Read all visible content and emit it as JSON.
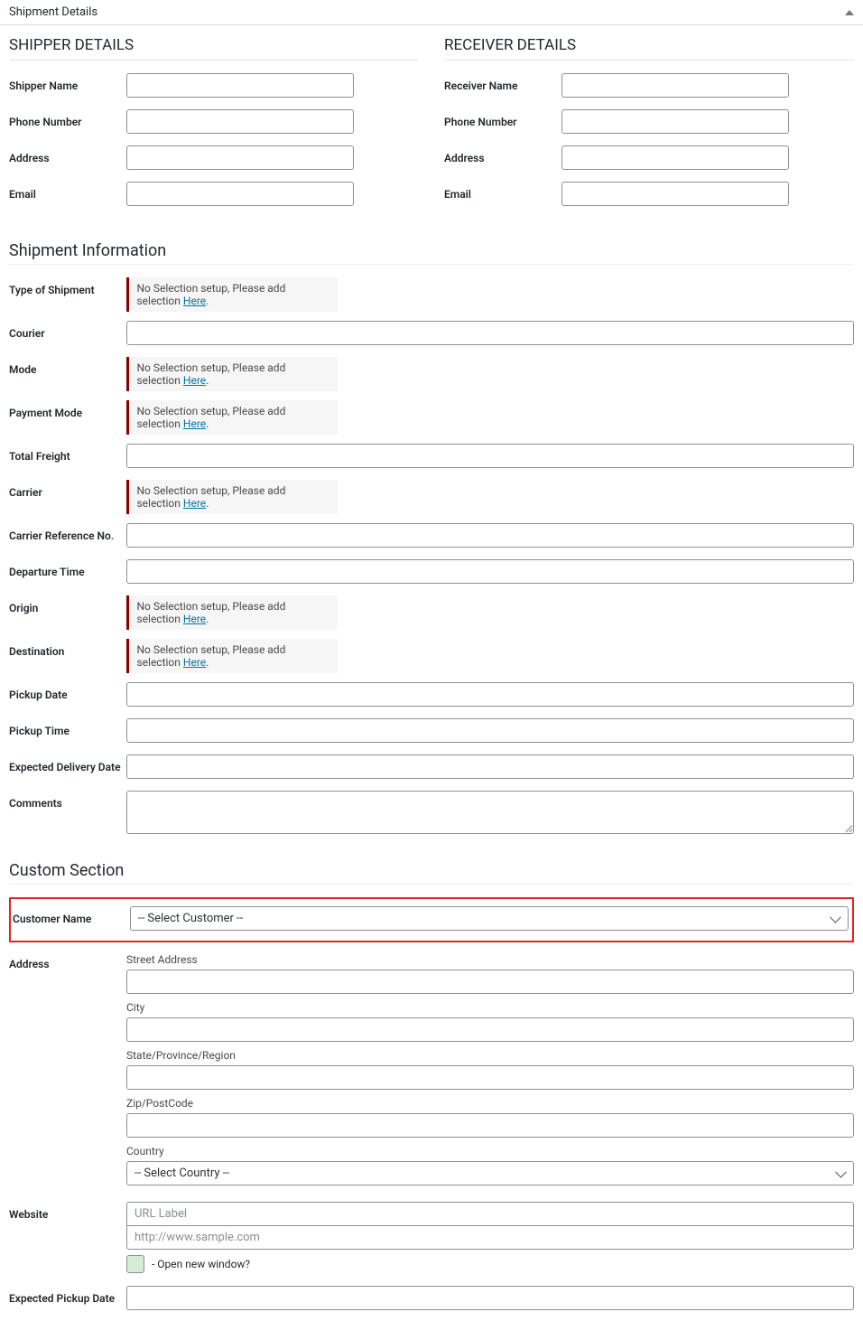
{
  "header": {
    "title": "Shipment Details"
  },
  "shipper": {
    "heading": "SHIPPER DETAILS",
    "name": {
      "label": "Shipper Name",
      "value": ""
    },
    "phone": {
      "label": "Phone Number",
      "value": ""
    },
    "address": {
      "label": "Address",
      "value": ""
    },
    "email": {
      "label": "Email",
      "value": ""
    }
  },
  "receiver": {
    "heading": "RECEIVER DETAILS",
    "name": {
      "label": "Receiver Name",
      "value": ""
    },
    "phone": {
      "label": "Phone Number",
      "value": ""
    },
    "address": {
      "label": "Address",
      "value": ""
    },
    "email": {
      "label": "Email",
      "value": ""
    }
  },
  "info": {
    "heading": "Shipment Information",
    "notice_prefix": "No Selection setup, Please add selection ",
    "notice_link": "Here",
    "notice_suffix": ".",
    "type": {
      "label": "Type of Shipment"
    },
    "courier": {
      "label": "Courier",
      "value": ""
    },
    "mode": {
      "label": "Mode"
    },
    "payment_mode": {
      "label": "Payment Mode"
    },
    "total_freight": {
      "label": "Total Freight",
      "value": ""
    },
    "carrier": {
      "label": "Carrier"
    },
    "carrier_ref": {
      "label": "Carrier Reference No.",
      "value": ""
    },
    "departure_time": {
      "label": "Departure Time",
      "value": ""
    },
    "origin": {
      "label": "Origin"
    },
    "destination": {
      "label": "Destination"
    },
    "pickup_date": {
      "label": "Pickup Date",
      "value": ""
    },
    "pickup_time": {
      "label": "Pickup Time",
      "value": ""
    },
    "expected_delivery": {
      "label": "Expected Delivery Date",
      "value": ""
    },
    "comments": {
      "label": "Comments",
      "value": ""
    }
  },
  "custom": {
    "heading": "Custom Section",
    "customer_name": {
      "label": "Customer Name",
      "selected": "-- Select Customer --"
    },
    "address": {
      "label": "Address",
      "street": {
        "label": "Street Address",
        "value": ""
      },
      "city": {
        "label": "City",
        "value": ""
      },
      "state": {
        "label": "State/Province/Region",
        "value": ""
      },
      "zip": {
        "label": "Zip/PostCode",
        "value": ""
      },
      "country": {
        "label": "Country",
        "selected": "-- Select Country --"
      }
    },
    "website": {
      "label": "Website",
      "url_label": {
        "placeholder": "URL Label",
        "value": ""
      },
      "url": {
        "placeholder": "http://www.sample.com",
        "value": ""
      },
      "new_window": {
        "label": "- Open new window?"
      }
    },
    "expected_pickup": {
      "label": "Expected Pickup Date",
      "value": ""
    }
  }
}
